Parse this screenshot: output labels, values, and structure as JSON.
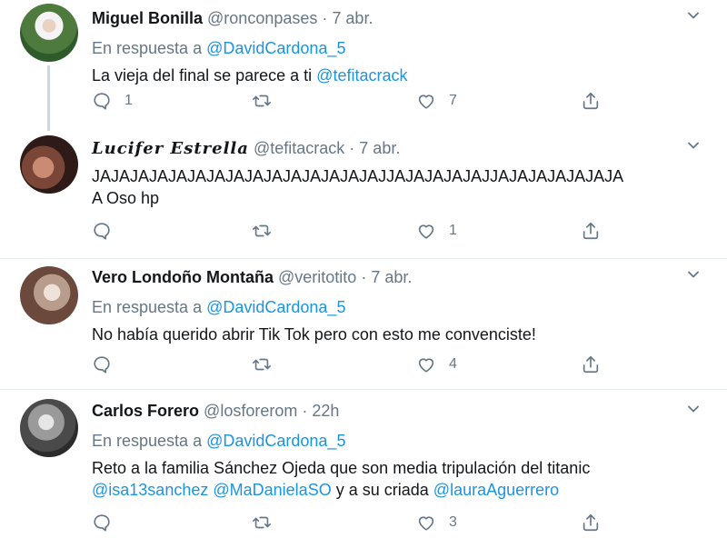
{
  "tweets": [
    {
      "name": "Miguel Bonilla",
      "handle": "@ronconpases",
      "time": "7 abr.",
      "reply_prefix": "En respuesta a",
      "reply_to": "@DavidCardona_5",
      "text": "La vieja del final se parece a ti",
      "mention": "@tefitacrack",
      "counts": {
        "reply": "1",
        "retweet": "",
        "like": "7"
      },
      "avatar_colors": [
        "#2f5a2a",
        "#7aa35a"
      ]
    },
    {
      "name": "Lucifer Estrella",
      "handle": "@tefitacrack",
      "time": "7 abr.",
      "text_line1": "JAJAJAJAJAJAJAJAJAJAJAJAJAJAJAJJAJAJAJAJAJJAJAJAJAJAJAJA",
      "text_line2": "A Oso hp",
      "counts": {
        "reply": "",
        "retweet": "",
        "like": "1"
      },
      "avatar_colors": [
        "#3a1f1a",
        "#b06f5a"
      ]
    },
    {
      "name": "Vero Londoño Montaña",
      "handle": "@veritotito",
      "time": "7 abr.",
      "reply_prefix": "En respuesta a",
      "reply_to": "@DavidCardona_5",
      "text": "No había querido abrir Tik Tok pero con esto me convenciste!",
      "counts": {
        "reply": "",
        "retweet": "",
        "like": "4"
      },
      "avatar_colors": [
        "#5a4036",
        "#d9c2b3"
      ]
    },
    {
      "name": "Carlos Forero",
      "handle": "@losforerom",
      "time": "22h",
      "reply_prefix": "En respuesta a",
      "reply_to": "@DavidCardona_5",
      "text_line1": "Reto a la familia Sánchez Ojeda que son media tripulación del titanic",
      "mention1": "@isa13sanchez",
      "mention2": "@MaDanielaSO",
      "mid_text": "y a su criada",
      "mention3": "@lauraAguerrero",
      "counts": {
        "reply": "",
        "retweet": "",
        "like": "3"
      },
      "avatar_colors": [
        "#2b2b2b",
        "#cfcfcf"
      ]
    }
  ],
  "separator": "·",
  "icons": [
    "reply-icon",
    "retweet-icon",
    "like-icon",
    "share-icon",
    "chevron-down-icon"
  ],
  "colors": {
    "link": "#1b95e0",
    "muted": "#657786",
    "text": "#14171a",
    "divider": "#e6ecf0",
    "thread": "#ccd6dd"
  }
}
